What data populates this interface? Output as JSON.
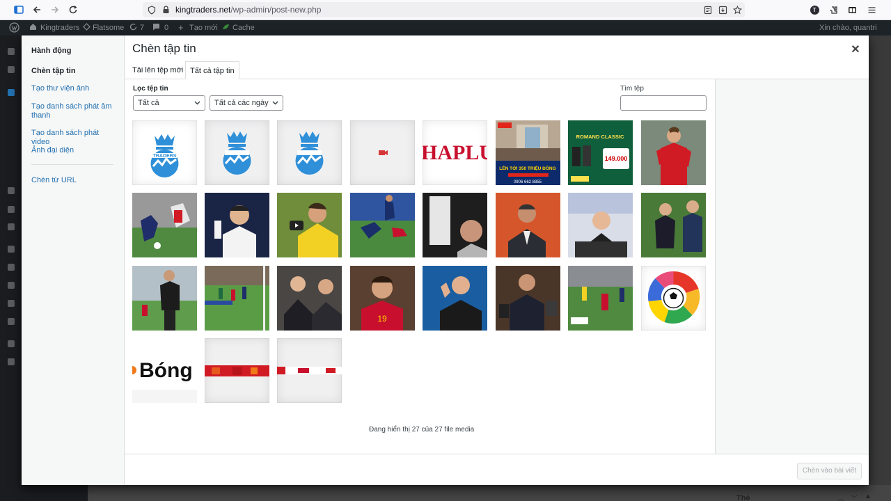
{
  "browser": {
    "url_host": "kingtraders.net",
    "url_path": "/wp-admin/post-new.php"
  },
  "admin_bar": {
    "site_name": "Kingtraders",
    "theme": "Flatsome",
    "updates_count": "7",
    "comments_count": "0",
    "new_label": "Tạo mới",
    "cache_label": "Cache",
    "greeting": "Xin chào, quantri"
  },
  "modal": {
    "title": "Chèn tập tin",
    "menu": {
      "heading": "Hành động",
      "items": [
        "Chèn tập tin",
        "Tạo thư viện ảnh",
        "Tạo danh sách phát âm thanh",
        "Tạo danh sách phát video",
        "Ảnh đại diện",
        "Chèn từ URL"
      ]
    },
    "tabs": [
      "Tải lên tệp mới",
      "Tất cả tập tin"
    ],
    "filter": {
      "label": "Lọc tệp tin",
      "type_value": "Tất cả",
      "date_value": "Tất cả các ngày"
    },
    "search": {
      "label": "Tìm tệp"
    },
    "media": [
      {
        "kind": "kingtraders-logo"
      },
      {
        "kind": "kingtraders-logo"
      },
      {
        "kind": "kingtraders-logo"
      },
      {
        "kind": "video-file"
      },
      {
        "kind": "phap-luat-logo",
        "text": "HAPLU"
      },
      {
        "kind": "vinpro-banner",
        "text": "LÊN TỚI 350 TRIỆU ĐỒNG",
        "phone": "0906 662 8855"
      },
      {
        "kind": "romand-banner",
        "text": "ROMAND CLASSIC",
        "price": "149.000"
      },
      {
        "kind": "football-photo"
      },
      {
        "kind": "football-photo"
      },
      {
        "kind": "football-photo"
      },
      {
        "kind": "football-video"
      },
      {
        "kind": "football-photo"
      },
      {
        "kind": "football-photo"
      },
      {
        "kind": "football-photo"
      },
      {
        "kind": "football-photo"
      },
      {
        "kind": "football-photo"
      },
      {
        "kind": "football-photo"
      },
      {
        "kind": "football-photo"
      },
      {
        "kind": "football-photo"
      },
      {
        "kind": "football-photo"
      },
      {
        "kind": "football-photo"
      },
      {
        "kind": "football-photo"
      },
      {
        "kind": "football-photo"
      },
      {
        "kind": "laliga-logo"
      },
      {
        "kind": "bong-logo",
        "text": "Bóng"
      },
      {
        "kind": "red-banner"
      },
      {
        "kind": "red-banner"
      }
    ],
    "status_text": "Đang hiển thị 27 của 27 file media",
    "insert_button": "Chèn vào bài viết"
  }
}
